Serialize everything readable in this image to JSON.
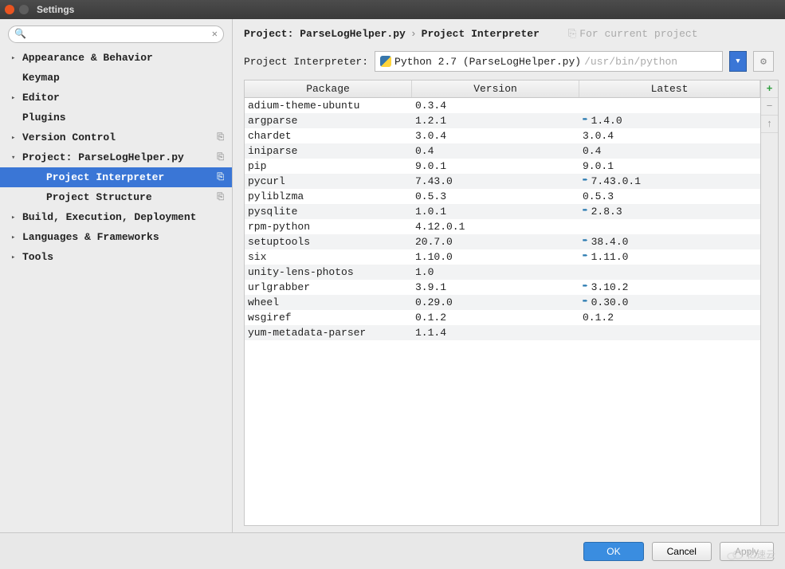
{
  "window": {
    "title": "Settings"
  },
  "search": {
    "placeholder": ""
  },
  "sidebar": {
    "items": [
      {
        "label": "Appearance & Behavior",
        "exp": "▸",
        "child": false,
        "sel": false,
        "badge": ""
      },
      {
        "label": "Keymap",
        "exp": "",
        "child": false,
        "sel": false,
        "badge": ""
      },
      {
        "label": "Editor",
        "exp": "▸",
        "child": false,
        "sel": false,
        "badge": ""
      },
      {
        "label": "Plugins",
        "exp": "",
        "child": false,
        "sel": false,
        "badge": ""
      },
      {
        "label": "Version Control",
        "exp": "▸",
        "child": false,
        "sel": false,
        "badge": "⎘"
      },
      {
        "label": "Project: ParseLogHelper.py",
        "exp": "▾",
        "child": false,
        "sel": false,
        "badge": "⎘"
      },
      {
        "label": "Project Interpreter",
        "exp": "",
        "child": true,
        "sel": true,
        "badge": "⎘"
      },
      {
        "label": "Project Structure",
        "exp": "",
        "child": true,
        "sel": false,
        "badge": "⎘"
      },
      {
        "label": "Build, Execution, Deployment",
        "exp": "▸",
        "child": false,
        "sel": false,
        "badge": ""
      },
      {
        "label": "Languages & Frameworks",
        "exp": "▸",
        "child": false,
        "sel": false,
        "badge": ""
      },
      {
        "label": "Tools",
        "exp": "▸",
        "child": false,
        "sel": false,
        "badge": ""
      }
    ]
  },
  "crumbs": {
    "root": "Project: ParseLogHelper.py",
    "sep": "›",
    "leaf": "Project Interpreter",
    "hint": "For current project"
  },
  "interpreter": {
    "label": "Project Interpreter:",
    "name": "Python 2.7 (ParseLogHelper.py)",
    "path": "/usr/bin/python"
  },
  "table": {
    "headers": {
      "pkg": "Package",
      "ver": "Version",
      "lat": "Latest"
    },
    "rows": [
      {
        "pkg": "adium-theme-ubuntu",
        "ver": "0.3.4",
        "lat": "",
        "upd": false
      },
      {
        "pkg": "argparse",
        "ver": "1.2.1",
        "lat": "1.4.0",
        "upd": true
      },
      {
        "pkg": "chardet",
        "ver": "3.0.4",
        "lat": "3.0.4",
        "upd": false
      },
      {
        "pkg": "iniparse",
        "ver": "0.4",
        "lat": "0.4",
        "upd": false
      },
      {
        "pkg": "pip",
        "ver": "9.0.1",
        "lat": "9.0.1",
        "upd": false
      },
      {
        "pkg": "pycurl",
        "ver": "7.43.0",
        "lat": "7.43.0.1",
        "upd": true
      },
      {
        "pkg": "pyliblzma",
        "ver": "0.5.3",
        "lat": "0.5.3",
        "upd": false
      },
      {
        "pkg": "pysqlite",
        "ver": "1.0.1",
        "lat": "2.8.3",
        "upd": true
      },
      {
        "pkg": "rpm-python",
        "ver": "4.12.0.1",
        "lat": "",
        "upd": false
      },
      {
        "pkg": "setuptools",
        "ver": "20.7.0",
        "lat": "38.4.0",
        "upd": true
      },
      {
        "pkg": "six",
        "ver": "1.10.0",
        "lat": "1.11.0",
        "upd": true
      },
      {
        "pkg": "unity-lens-photos",
        "ver": "1.0",
        "lat": "",
        "upd": false
      },
      {
        "pkg": "urlgrabber",
        "ver": "3.9.1",
        "lat": "3.10.2",
        "upd": true
      },
      {
        "pkg": "wheel",
        "ver": "0.29.0",
        "lat": "0.30.0",
        "upd": true
      },
      {
        "pkg": "wsgiref",
        "ver": "0.1.2",
        "lat": "0.1.2",
        "upd": false
      },
      {
        "pkg": "yum-metadata-parser",
        "ver": "1.1.4",
        "lat": "",
        "upd": false
      }
    ]
  },
  "sidebtns": {
    "add": "+",
    "remove": "−",
    "up": "↑"
  },
  "buttons": {
    "ok": "OK",
    "cancel": "Cancel",
    "apply": "Apply"
  },
  "watermark": "亿速云"
}
